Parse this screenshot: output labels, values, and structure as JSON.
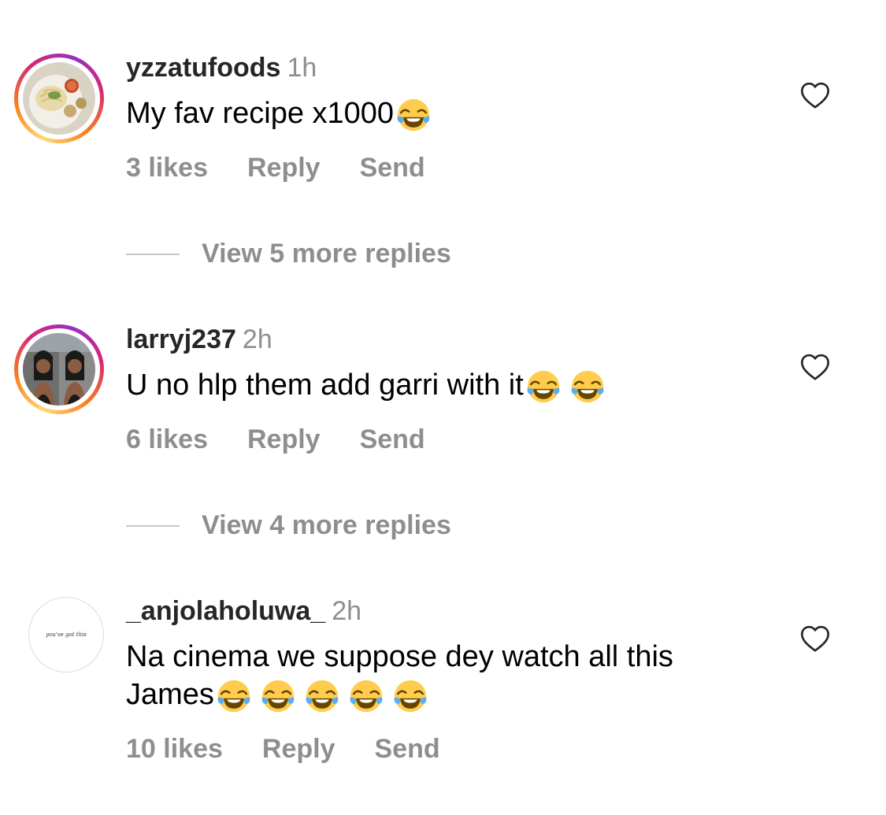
{
  "comments": [
    {
      "username": "yzzatufoods",
      "time": "1h",
      "text": "My fav recipe x1000",
      "emoji_count": 1,
      "likes": "3 likes",
      "reply": "Reply",
      "send": "Send",
      "view_more": "View 5 more replies"
    },
    {
      "username": "larryj237",
      "time": "2h",
      "text": "U no hlp them add garri with it",
      "emoji_count": 2,
      "likes": "6 likes",
      "reply": "Reply",
      "send": "Send",
      "view_more": "View 4 more replies"
    },
    {
      "username": "_anjolaholuwa_",
      "time": "2h",
      "text_line1": "Na cinema we suppose dey watch all this",
      "text_line2": "James",
      "emoji_count": 5,
      "likes": "10 likes",
      "reply": "Reply",
      "send": "Send",
      "avatar_text": "you've got this"
    }
  ],
  "icons": {
    "like": "heart-outline-icon",
    "emoji": "face-with-tears-of-joy-icon"
  },
  "colors": {
    "secondary_text": "#8e8e8e",
    "username": "#262626",
    "story_ring": [
      "#feda75",
      "#fa7e1e",
      "#d62976",
      "#962fbf"
    ]
  }
}
